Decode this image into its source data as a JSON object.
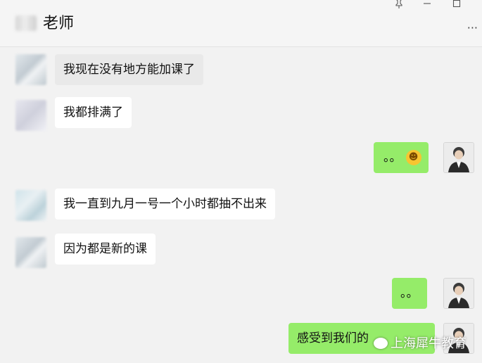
{
  "header": {
    "title": "老师",
    "pin_icon": "pin-icon",
    "minimize_icon": "minimize-icon",
    "maximize_icon": "maximize-icon",
    "more_icon": "more-icon"
  },
  "messages": [
    {
      "side": "in",
      "text": "我现在没有地方能加课了"
    },
    {
      "side": "in",
      "text": "我都排满了"
    },
    {
      "side": "out",
      "text": "。。"
    },
    {
      "side": "in",
      "text": "我一直到九月一号一个小时都抽不出来"
    },
    {
      "side": "in",
      "text": "因为都是新的课"
    },
    {
      "side": "out",
      "text": "。。"
    },
    {
      "side": "out",
      "text": "感受到我们的"
    }
  ],
  "emoji": "grin-sweat-emoji",
  "watermark": {
    "text": "上海犀牛教育",
    "icon": "wechat-icon"
  },
  "colors": {
    "outgoing_bubble": "#95ec69",
    "incoming_bubble": "#ffffff",
    "background": "#f2f2f2"
  }
}
